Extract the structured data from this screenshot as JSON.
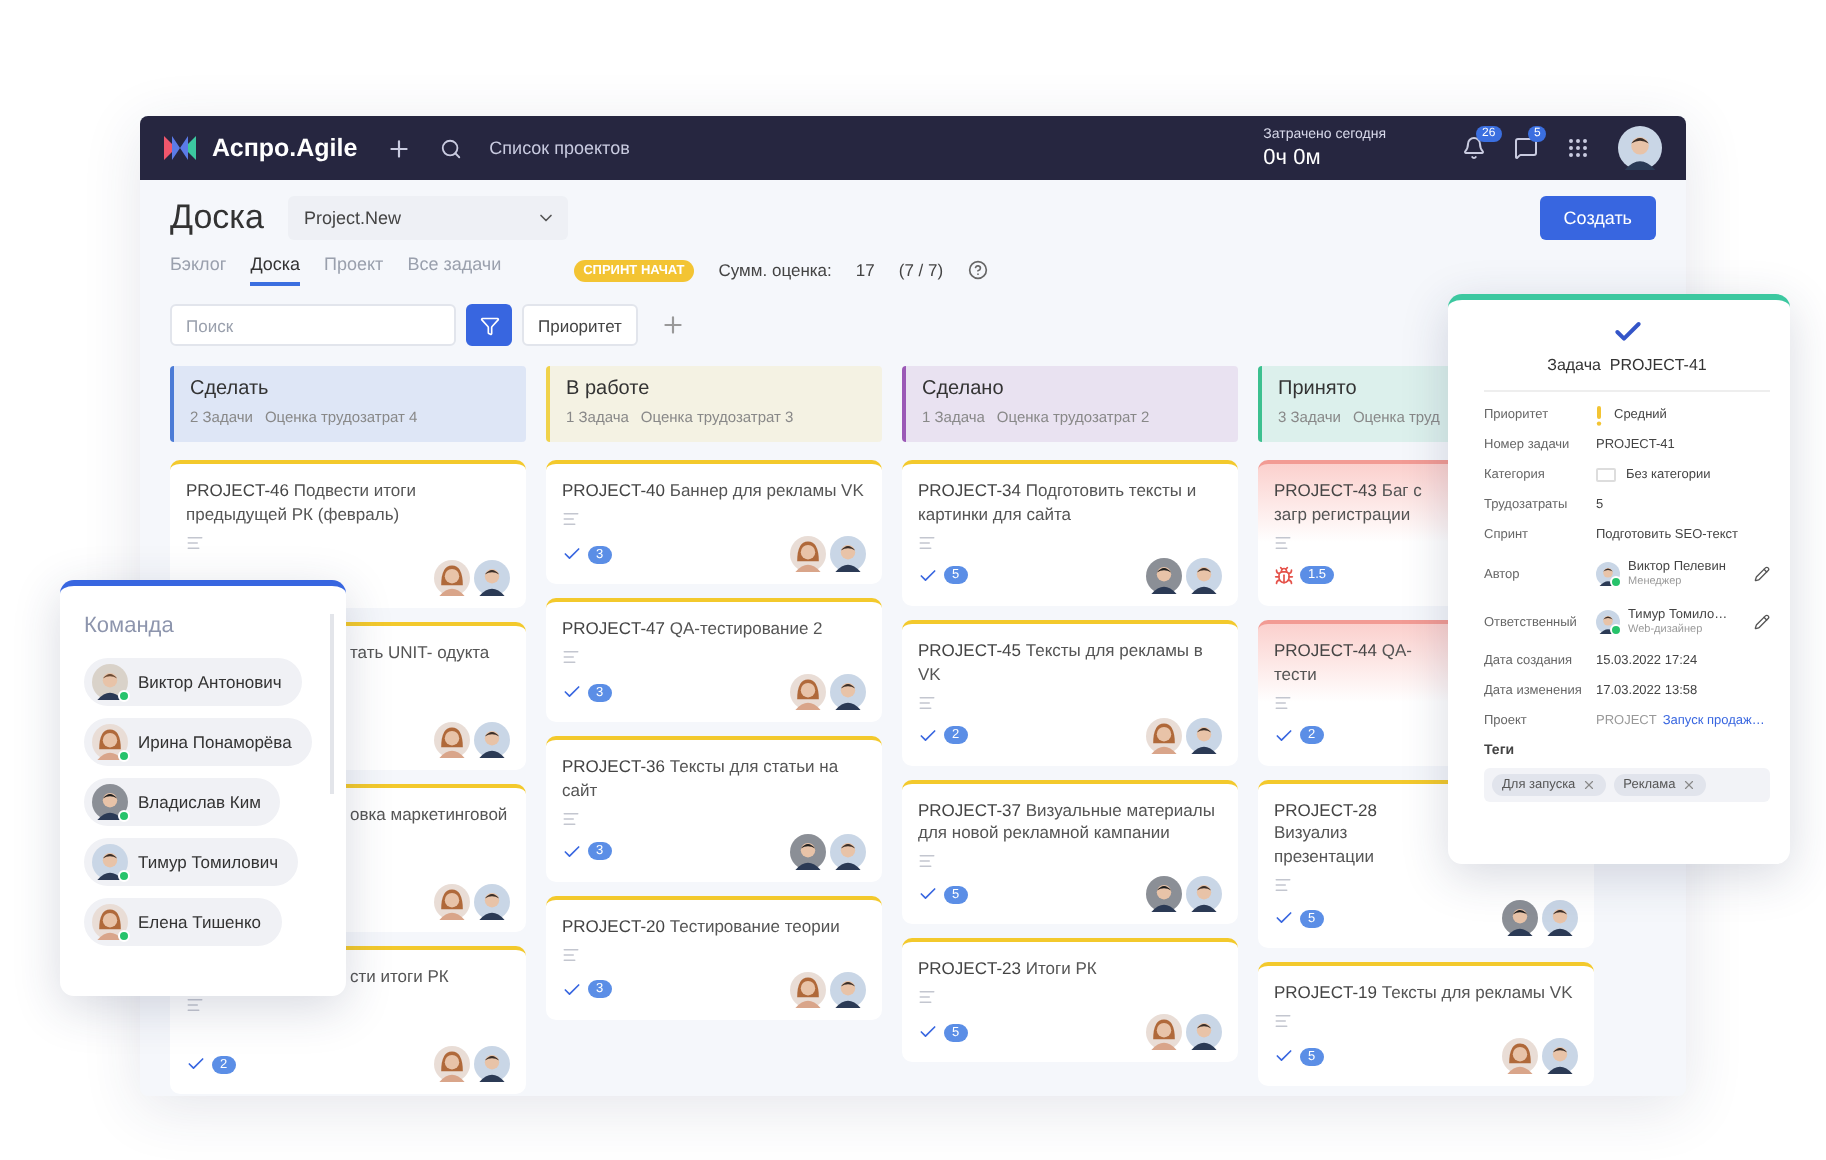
{
  "topbar": {
    "brand": "Аспро.Agile",
    "projects_link": "Список проектов",
    "time_label": "Затрачено сегодня",
    "time_value": "0ч 0м",
    "notifications": "26",
    "messages": "5"
  },
  "header": {
    "title": "Доска",
    "project": "Project.New",
    "create": "Создать"
  },
  "tabs": [
    {
      "label": "Бэклог",
      "selected": false
    },
    {
      "label": "Доска",
      "selected": true
    },
    {
      "label": "Проект",
      "selected": false
    },
    {
      "label": "Все задачи",
      "selected": false
    }
  ],
  "sprint": {
    "badge": "СПРИНТ НАЧАТ",
    "sum_label": "Сумм. оценка:",
    "sum_value": "17",
    "ratio": "(7 / 7)"
  },
  "toolbar": {
    "search_placeholder": "Поиск",
    "priority_button": "Приоритет"
  },
  "columns": [
    {
      "title": "Сделать",
      "color": "#4b7bd6",
      "count": "2 Задачи",
      "estimate": "Оценка трудозатрат 4",
      "cards": [
        {
          "kind": "full",
          "id": "PROJECT-46",
          "title": "Подвести итоги предыдущей РК (февраль)",
          "urgent": false,
          "description": true,
          "avatars": [
            {
              "kind": "woman"
            },
            {
              "kind": "man"
            }
          ]
        },
        {
          "kind": "cut-left",
          "title": "тать UNIT- одукта",
          "urgent": false,
          "description": false,
          "avatars": [
            {
              "kind": "woman"
            },
            {
              "kind": "man"
            }
          ]
        },
        {
          "kind": "cut-left",
          "title": "овка маркетинговой",
          "urgent": false,
          "description": false,
          "avatars": [
            {
              "kind": "woman"
            },
            {
              "kind": "man"
            }
          ]
        },
        {
          "kind": "cut-left",
          "title": "сти итоги РК",
          "urgent": false,
          "description": true,
          "badge": {
            "kind": "check",
            "value": "2"
          },
          "avatars": [
            {
              "kind": "woman"
            },
            {
              "kind": "man"
            }
          ]
        }
      ]
    },
    {
      "title": "В работе",
      "color": "#f0d24a",
      "count": "1 Задача",
      "estimate": "Оценка трудозатрат 3",
      "cards": [
        {
          "kind": "full",
          "id": "PROJECT-40",
          "title": "Баннер для рекламы VK",
          "urgent": false,
          "description": true,
          "badge": {
            "kind": "check",
            "value": "3"
          },
          "avatars": [
            {
              "kind": "woman"
            },
            {
              "kind": "man"
            }
          ]
        },
        {
          "kind": "full",
          "id": "PROJECT-47",
          "title": "QA-тестирование 2",
          "urgent": false,
          "description": true,
          "badge": {
            "kind": "check",
            "value": "3"
          },
          "avatars": [
            {
              "kind": "woman"
            },
            {
              "kind": "man"
            }
          ]
        },
        {
          "kind": "full",
          "id": "PROJECT-36",
          "title": "Тексты для статьи на сайт",
          "urgent": false,
          "description": true,
          "badge": {
            "kind": "check",
            "value": "3"
          },
          "avatars": [
            {
              "kind": "man-dark"
            },
            {
              "kind": "man"
            }
          ]
        },
        {
          "kind": "full",
          "id": "PROJECT-20",
          "title": "Тестирование теории",
          "urgent": false,
          "description": true,
          "badge": {
            "kind": "check",
            "value": "3"
          },
          "avatars": [
            {
              "kind": "woman"
            },
            {
              "kind": "man"
            }
          ]
        }
      ]
    },
    {
      "title": "Сделано",
      "color": "#9b59b6",
      "count": "1 Задача",
      "estimate": "Оценка трудозатрат 2",
      "cards": [
        {
          "kind": "full",
          "id": "PROJECT-34",
          "title": "Подготовить тексты и картинки для сайта",
          "urgent": false,
          "description": true,
          "badge": {
            "kind": "check",
            "value": "5"
          },
          "avatars": [
            {
              "kind": "man-dark"
            },
            {
              "kind": "man"
            }
          ]
        },
        {
          "kind": "full",
          "id": "PROJECT-45",
          "title": "Тексты для рекламы в VK",
          "urgent": false,
          "description": true,
          "badge": {
            "kind": "check",
            "value": "2"
          },
          "avatars": [
            {
              "kind": "woman"
            },
            {
              "kind": "man"
            }
          ]
        },
        {
          "kind": "full",
          "id": "PROJECT-37",
          "title": "Визуальные материалы для новой рекламной кампании",
          "urgent": false,
          "description": true,
          "badge": {
            "kind": "check",
            "value": "5"
          },
          "avatars": [
            {
              "kind": "man-dark"
            },
            {
              "kind": "man"
            }
          ]
        },
        {
          "kind": "full",
          "id": "PROJECT-23",
          "title": "Итоги РК",
          "urgent": false,
          "description": true,
          "badge": {
            "kind": "check",
            "value": "5"
          },
          "avatars": [
            {
              "kind": "woman"
            },
            {
              "kind": "man"
            }
          ]
        }
      ]
    },
    {
      "title": "Принято",
      "color": "#3cc08f",
      "count": "3 Задачи",
      "estimate": "Оценка труд",
      "cards": [
        {
          "kind": "cut-right",
          "id": "PROJECT-43",
          "title": "Баг с загр регистрации",
          "urgent": true,
          "description": true,
          "badge": {
            "kind": "bug",
            "value": "1.5"
          }
        },
        {
          "kind": "cut-right",
          "id": "PROJECT-44",
          "title": "QA-тести",
          "urgent": true,
          "description": true,
          "badge": {
            "kind": "check",
            "value": "2"
          }
        },
        {
          "kind": "cut-right",
          "id": "PROJECT-28",
          "title": "Визуализ презентации",
          "urgent": false,
          "description": true,
          "badge": {
            "kind": "check",
            "value": "5"
          },
          "avatars": [
            {
              "kind": "man-dark"
            },
            {
              "kind": "man"
            }
          ]
        },
        {
          "kind": "full",
          "id": "PROJECT-19",
          "title": "Тексты для рекламы VK",
          "urgent": false,
          "description": true,
          "badge": {
            "kind": "check",
            "value": "5"
          },
          "avatars": [
            {
              "kind": "woman"
            },
            {
              "kind": "man"
            }
          ]
        }
      ]
    }
  ],
  "team_panel": {
    "title": "Команда",
    "members": [
      {
        "name": "Виктор Антонович",
        "kind": "man-beard",
        "online": true
      },
      {
        "name": "Ирина Понаморёва",
        "kind": "woman",
        "online": true
      },
      {
        "name": "Владислав Ким",
        "kind": "man-dark",
        "online": true
      },
      {
        "name": "Тимур Томилович",
        "kind": "man",
        "online": true
      },
      {
        "name": "Елена Тишенко",
        "kind": "woman",
        "online": true
      }
    ]
  },
  "task_panel": {
    "title_label": "Задача",
    "title_id": "PROJECT-41",
    "fields": [
      {
        "kind": "priority",
        "label": "Приоритет",
        "value": "Средний"
      },
      {
        "kind": "text",
        "label": "Номер задачи",
        "value": "PROJECT-41"
      },
      {
        "kind": "category",
        "label": "Категория",
        "value": "Без категории"
      },
      {
        "kind": "text",
        "label": "Трудозатраты",
        "value": "5"
      },
      {
        "kind": "text",
        "label": "Спринт",
        "value": "Подготовить SEO-текст"
      },
      {
        "kind": "person",
        "label": "Автор",
        "value": "Виктор Пелевин",
        "role": "Менеджер"
      },
      {
        "kind": "person",
        "label": "Ответственный",
        "value": "Тимур Томило…",
        "role": "Web-дизайнер"
      },
      {
        "kind": "text",
        "label": "Дата создания",
        "value": "15.03.2022 17:24"
      },
      {
        "kind": "text",
        "label": "Дата изменения",
        "value": "17.03.2022 13:58"
      },
      {
        "kind": "link",
        "label": "Проект",
        "prefix": "PROJECT",
        "value": "Запуск продаж…"
      }
    ],
    "tags_label": "Теги",
    "tags": [
      "Для запуска",
      "Реклама"
    ]
  }
}
